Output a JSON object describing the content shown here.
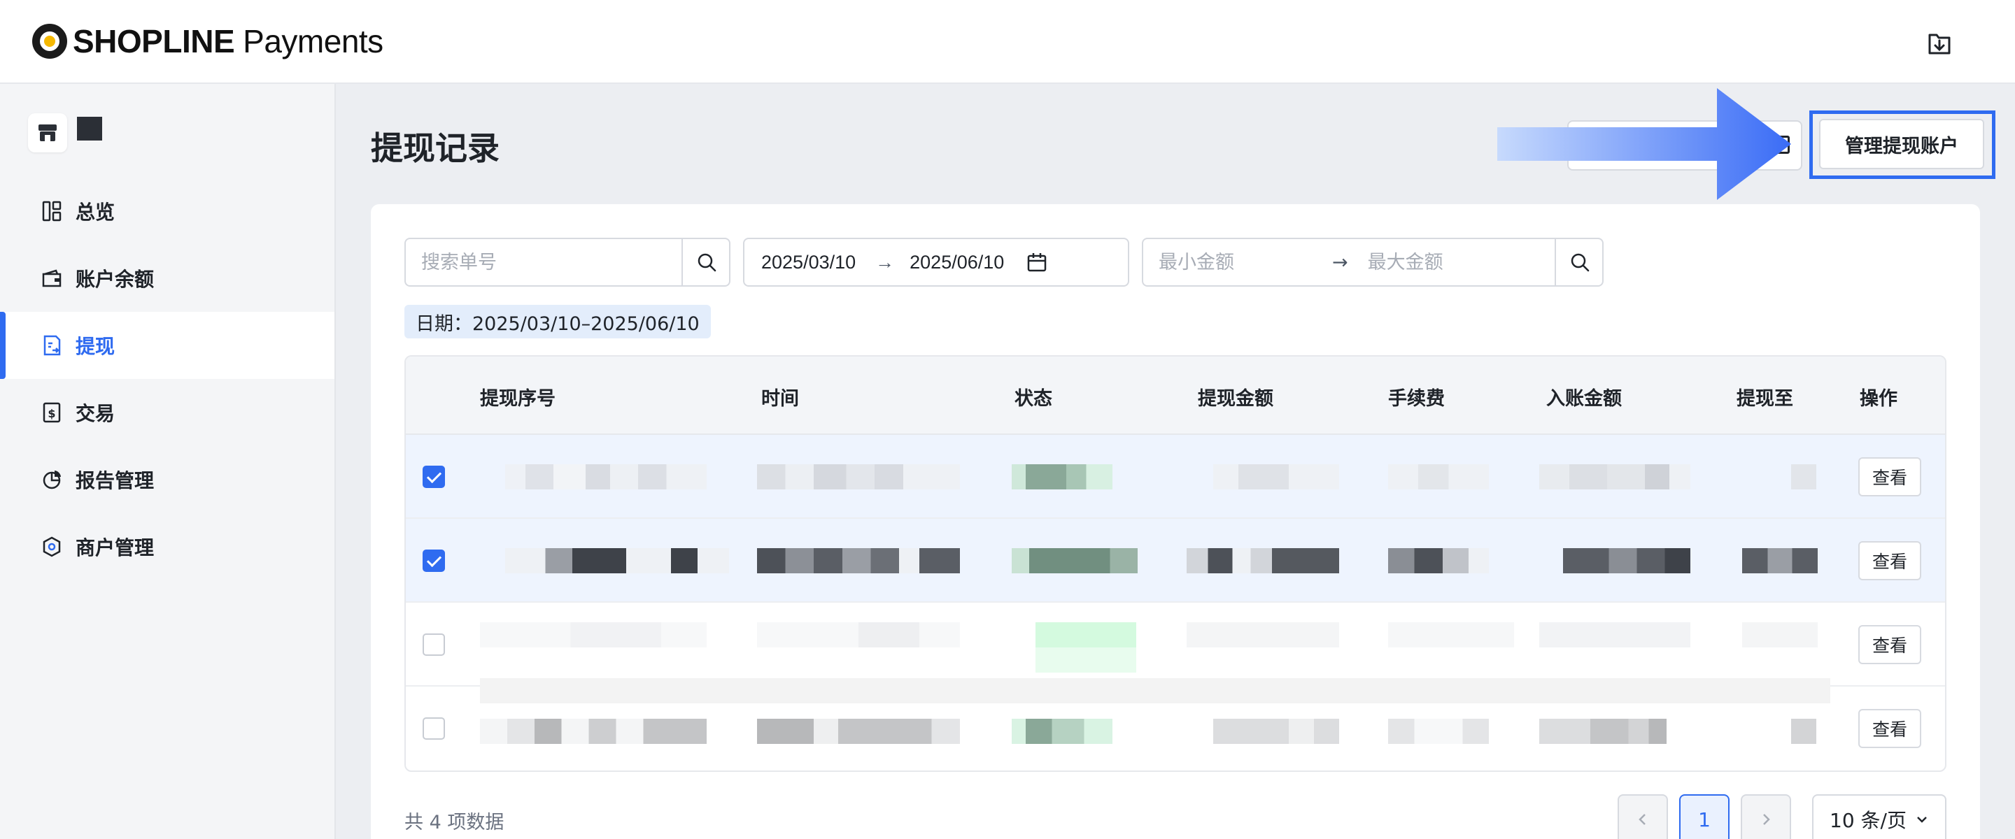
{
  "header": {
    "brand": "SHOPLINE",
    "product": "Payments",
    "download_icon": "download-icon"
  },
  "sidebar": {
    "store_icon": "store-icon",
    "items": [
      {
        "label": "总览",
        "icon": "dashboard-icon",
        "active": false
      },
      {
        "label": "账户余额",
        "icon": "wallet-icon",
        "active": false
      },
      {
        "label": "提现",
        "icon": "withdraw-icon",
        "active": true
      },
      {
        "label": "交易",
        "icon": "transaction-icon",
        "active": false
      },
      {
        "label": "报告管理",
        "icon": "report-icon",
        "active": false
      },
      {
        "label": "商户管理",
        "icon": "merchant-icon",
        "active": false
      }
    ]
  },
  "page": {
    "title": "提现记录",
    "manage_button": "管理提现账户"
  },
  "filters": {
    "search_placeholder": "搜索单号",
    "date_start": "2025/03/10",
    "date_end": "2025/06/10",
    "range_arrow": "→",
    "min_amount_placeholder": "最小金额",
    "max_amount_placeholder": "最大金额",
    "active_tag": "日期：2025/03/10–2025/06/10"
  },
  "table": {
    "columns": [
      "提现序号",
      "时间",
      "状态",
      "提现金额",
      "手续费",
      "入账金额",
      "提现至",
      "操作"
    ],
    "rows": [
      {
        "checked": true,
        "action": "查看"
      },
      {
        "checked": true,
        "action": "查看"
      },
      {
        "checked": false,
        "action": "查看"
      },
      {
        "checked": false,
        "action": "查看"
      }
    ]
  },
  "pagination": {
    "total": "共 4 项数据",
    "current_page": "1",
    "page_size": "10 条/页"
  },
  "colors": {
    "accent": "#2f6bf0",
    "arrow": "#3b6ff5"
  }
}
